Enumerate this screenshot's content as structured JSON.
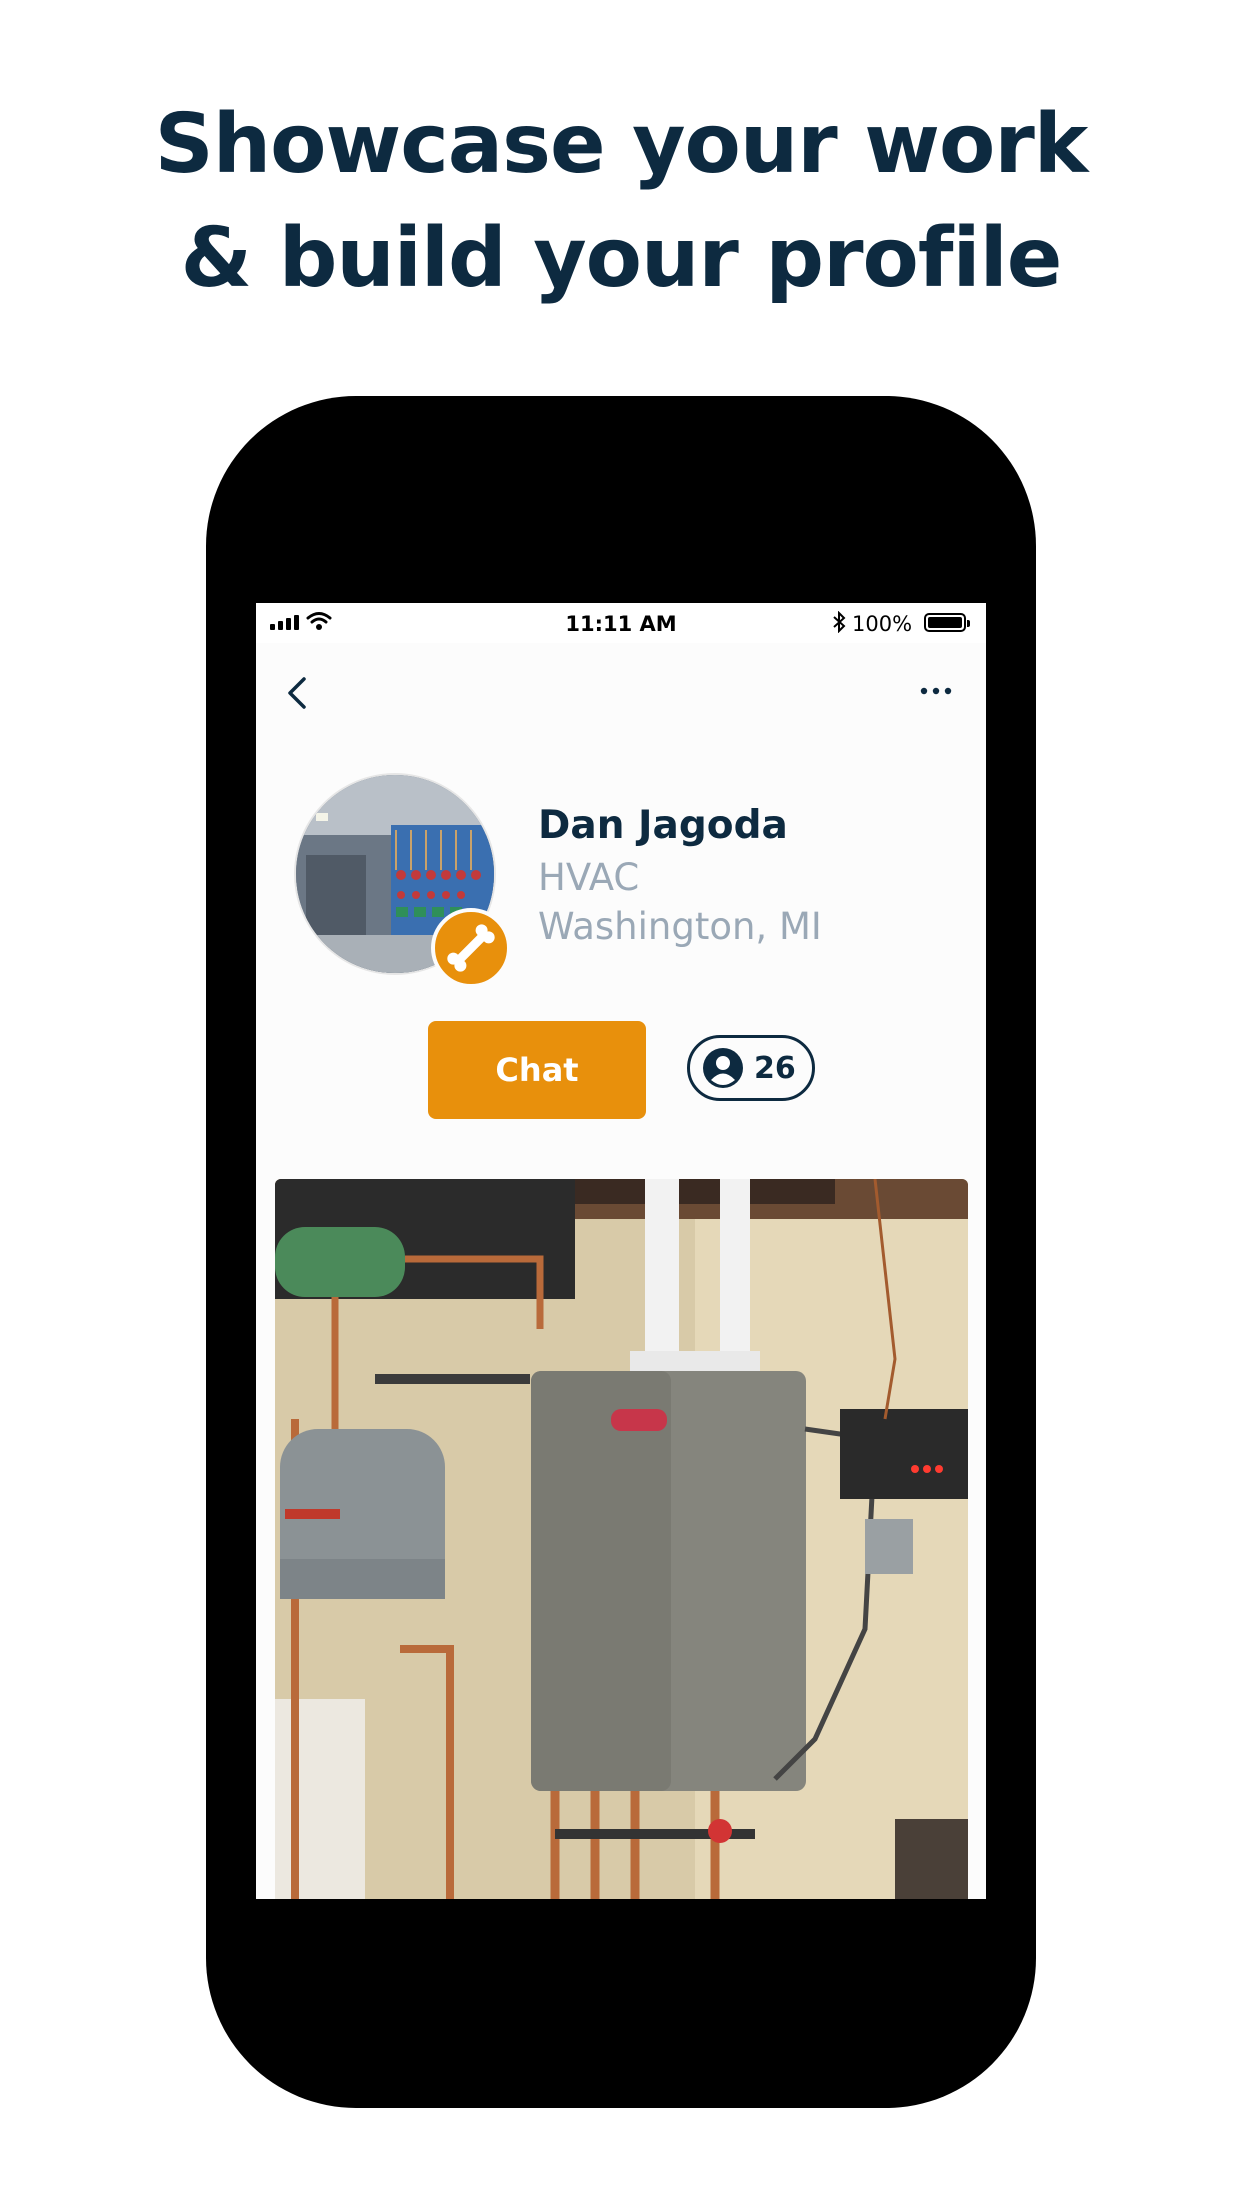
{
  "headline": {
    "line1": "Showcase your work",
    "line2": "& build your profile"
  },
  "status_bar": {
    "time": "11:11 AM",
    "battery_percent": "100%",
    "bluetooth_icon": "bluetooth-icon",
    "signal_icon": "cellular-signal-icon",
    "wifi_icon": "wifi-icon"
  },
  "nav": {
    "back_icon": "chevron-left-icon",
    "more_icon": "more-horizontal-icon"
  },
  "profile": {
    "name": "Dan Jagoda",
    "trade": "HVAC",
    "location": "Washington, MI",
    "badge_icon": "wrench-icon"
  },
  "actions": {
    "chat_label": "Chat",
    "followers_count": "26",
    "followers_icon": "person-circle-icon"
  },
  "colors": {
    "accent": "#e8900c",
    "navy": "#0d2a40",
    "muted": "#9aa8b6"
  }
}
